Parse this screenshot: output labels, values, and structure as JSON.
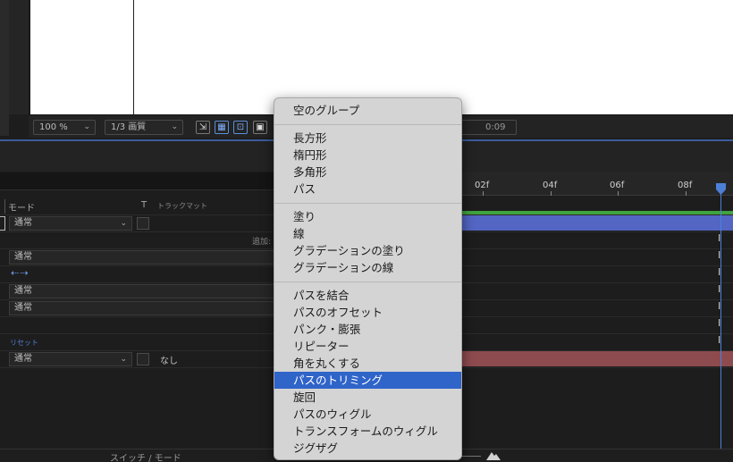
{
  "viewer": {
    "zoom": "100 %",
    "resolution": "1/3 画質",
    "timecode_partial": "0:09"
  },
  "layers": {
    "col_mode": "モード",
    "col_t": "T",
    "col_track_matte": "トラックマット",
    "mode_normal": "通常",
    "add_label": "追加:",
    "reset_label": "リセット",
    "none_label": "なし"
  },
  "ruler": {
    "ticks": [
      "02f",
      "04f",
      "06f",
      "08f"
    ]
  },
  "context_menu": {
    "items": [
      {
        "label": "空のグループ"
      },
      {
        "label": "長方形"
      },
      {
        "label": "楕円形"
      },
      {
        "label": "多角形"
      },
      {
        "label": "パス"
      },
      {
        "label": "塗り"
      },
      {
        "label": "線"
      },
      {
        "label": "グラデーションの塗り"
      },
      {
        "label": "グラデーションの線"
      },
      {
        "label": "パスを結合"
      },
      {
        "label": "パスのオフセット"
      },
      {
        "label": "パンク・膨張"
      },
      {
        "label": "リピーター"
      },
      {
        "label": "角を丸くする"
      },
      {
        "label": "パスのトリミング"
      },
      {
        "label": "旋回"
      },
      {
        "label": "パスのウィグル"
      },
      {
        "label": "トランスフォームのウィグル"
      },
      {
        "label": "ジグザグ"
      }
    ],
    "selected_index": 14
  },
  "bottom": {
    "switch_mode": "スイッチ / モード"
  },
  "colors": {
    "menu_highlight": "#2f64c9",
    "playhead": "#4d7fd8",
    "layer_bar_blue": "#5366c4",
    "layer_bar_red": "#8e4b4f",
    "work_area_green": "#3fa33f"
  }
}
